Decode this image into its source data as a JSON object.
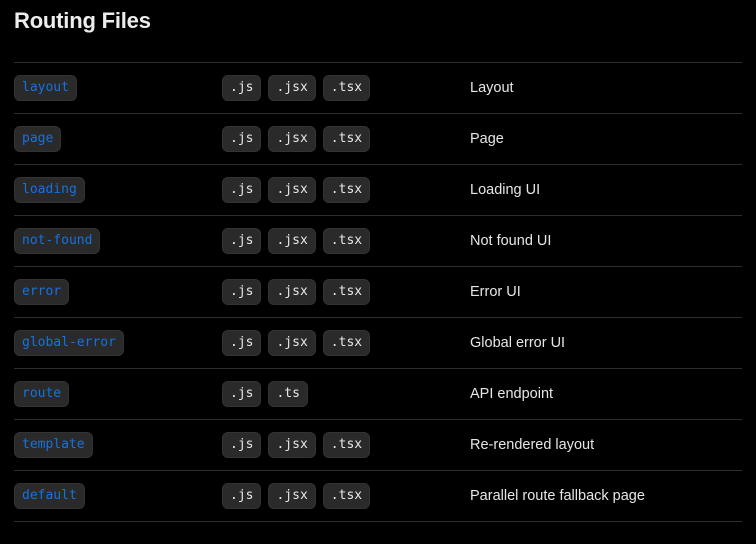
{
  "heading": {
    "title": "Routing Files"
  },
  "colors": {
    "background": "#000000",
    "title_text": "#ededed",
    "divider": "#2d2d2d",
    "chip_background": "#2a2a2a",
    "chip_border": "#333333",
    "filename_text": "#1672de",
    "extension_text": "#e8e8e8",
    "description_text": "#e6e6e6"
  },
  "table": {
    "rows": [
      {
        "file": "layout",
        "extensions": [
          ".js",
          ".jsx",
          ".tsx"
        ],
        "description": "Layout"
      },
      {
        "file": "page",
        "extensions": [
          ".js",
          ".jsx",
          ".tsx"
        ],
        "description": "Page"
      },
      {
        "file": "loading",
        "extensions": [
          ".js",
          ".jsx",
          ".tsx"
        ],
        "description": "Loading UI"
      },
      {
        "file": "not-found",
        "extensions": [
          ".js",
          ".jsx",
          ".tsx"
        ],
        "description": "Not found UI"
      },
      {
        "file": "error",
        "extensions": [
          ".js",
          ".jsx",
          ".tsx"
        ],
        "description": "Error UI"
      },
      {
        "file": "global-error",
        "extensions": [
          ".js",
          ".jsx",
          ".tsx"
        ],
        "description": "Global error UI"
      },
      {
        "file": "route",
        "extensions": [
          ".js",
          ".ts"
        ],
        "description": "API endpoint"
      },
      {
        "file": "template",
        "extensions": [
          ".js",
          ".jsx",
          ".tsx"
        ],
        "description": "Re-rendered layout"
      },
      {
        "file": "default",
        "extensions": [
          ".js",
          ".jsx",
          ".tsx"
        ],
        "description": "Parallel route fallback page"
      }
    ]
  }
}
